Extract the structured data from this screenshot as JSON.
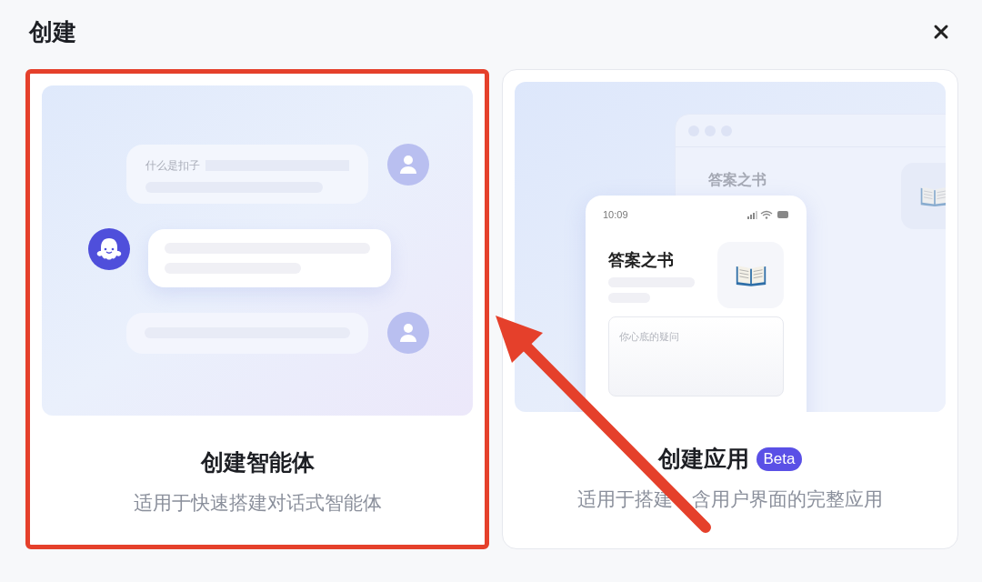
{
  "dialog": {
    "title": "创建"
  },
  "cards": [
    {
      "kind": "agent",
      "title": "创建智能体",
      "description": "适用于快速搭建对话式智能体",
      "highlighted": true,
      "illustration": {
        "question": "什么是扣子"
      }
    },
    {
      "kind": "app",
      "title": "创建应用",
      "badge": "Beta",
      "description_parts": [
        "适用于搭建",
        "含用户界面的完整应用"
      ],
      "highlighted": false,
      "illustration": {
        "back_title": "答案之书",
        "time": "10:09",
        "app_title": "答案之书",
        "placeholder": "你心底的疑问"
      }
    }
  ],
  "annotations": [
    {
      "kind": "arrow"
    }
  ]
}
